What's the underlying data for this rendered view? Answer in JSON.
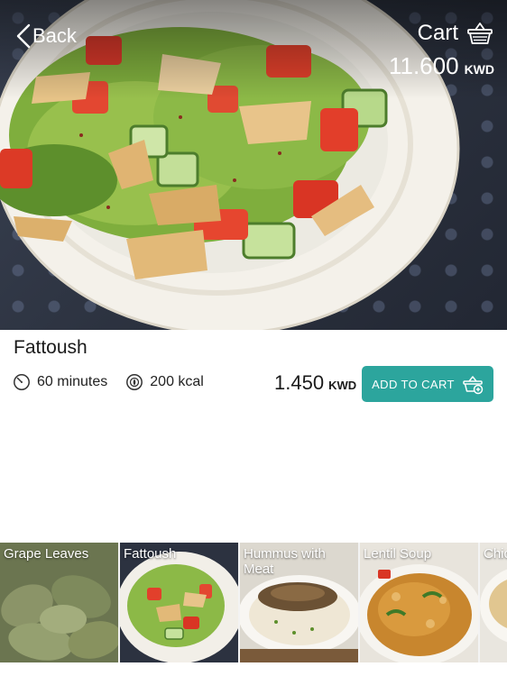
{
  "nav": {
    "back_label": "Back",
    "cart_label": "Cart",
    "cart_total": "11.600",
    "cart_currency": "KWD"
  },
  "item": {
    "name": "Fattoush",
    "duration": "60 minutes",
    "calories": "200 kcal",
    "price": "1.450",
    "currency": "KWD",
    "add_label": "ADD TO CART"
  },
  "menu": [
    {
      "label": "Grape Leaves"
    },
    {
      "label": "Fattoush"
    },
    {
      "label": "Hummus with Meat"
    },
    {
      "label": "Lentil Soup"
    },
    {
      "label": "Chic"
    }
  ],
  "colors": {
    "accent": "#2ca59d",
    "text": "#1a1a1a",
    "hero_bg": "#2a303d"
  },
  "icons": {
    "back": "chevron-left-icon",
    "cart": "basket-icon",
    "time": "clock-icon",
    "calories": "calorie-icon",
    "add": "basket-add-icon"
  }
}
